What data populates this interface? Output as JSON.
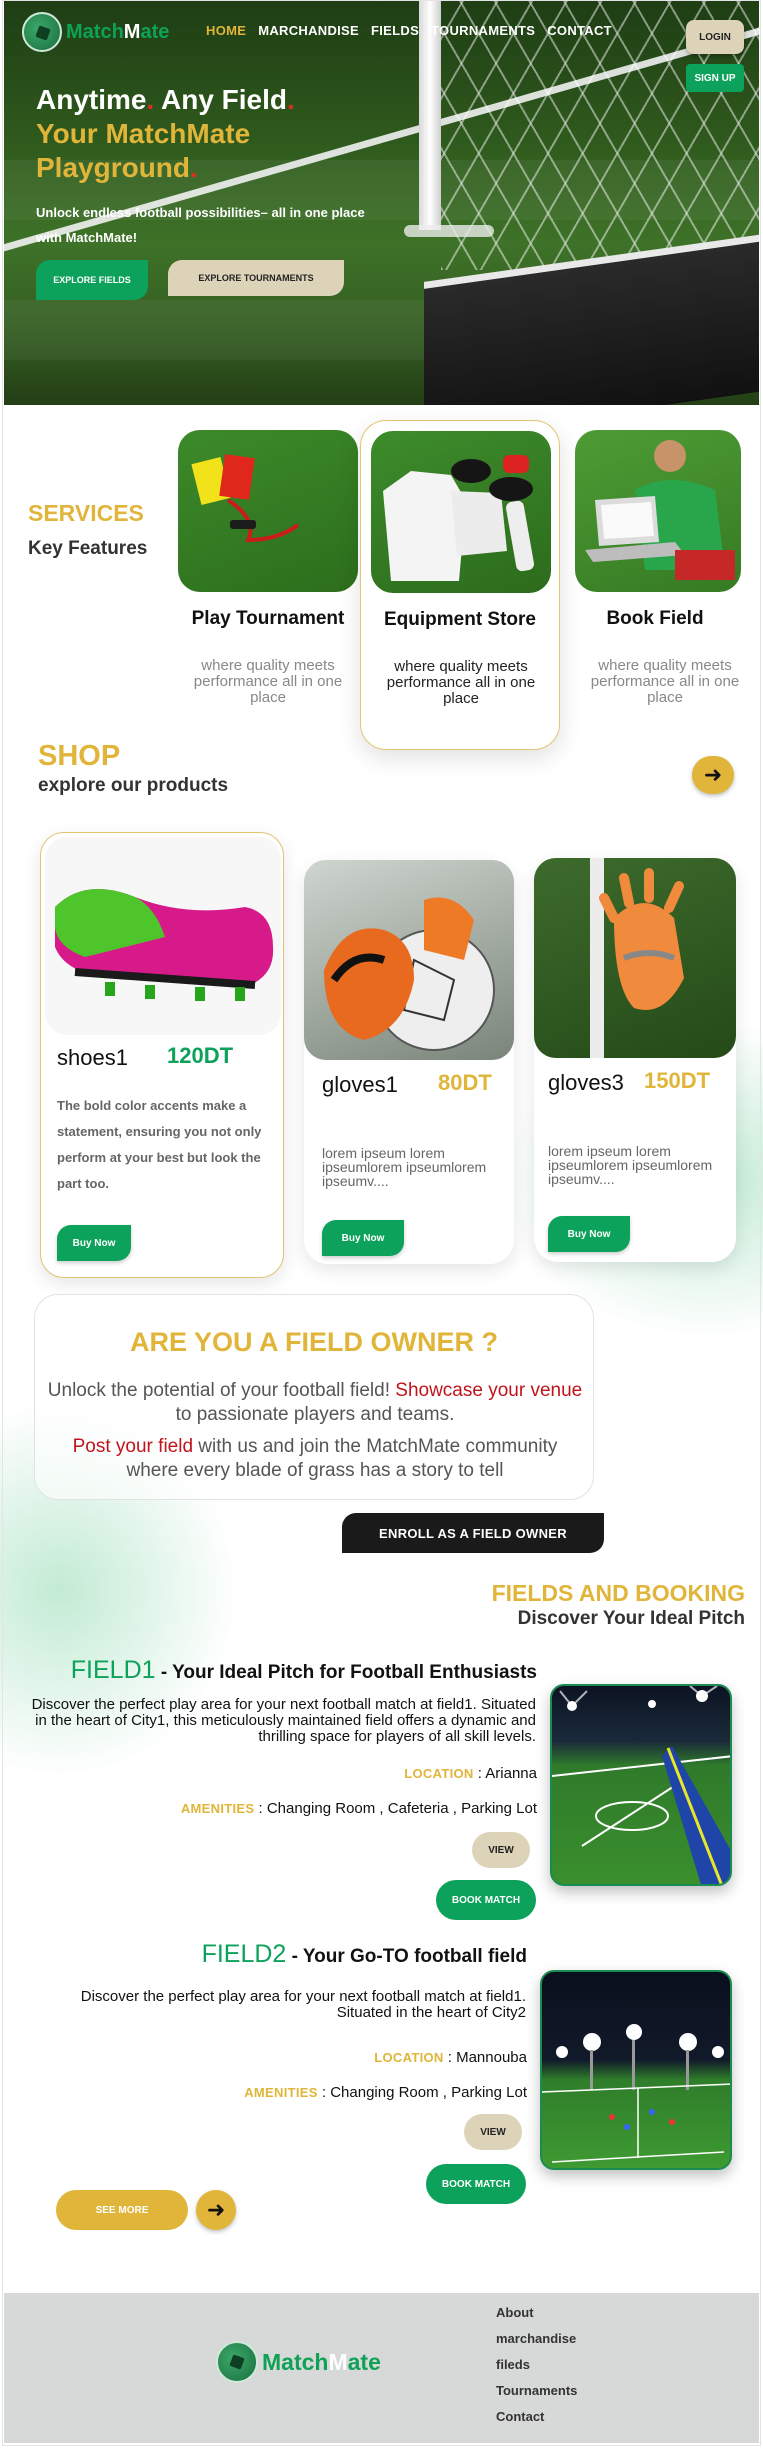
{
  "brand": {
    "name_pre": "Match",
    "name_m": "M",
    "name_post": "ate"
  },
  "nav": {
    "links": [
      "HOME",
      "MARCHANDISE",
      "FIELDS",
      "TOURNAMENTS",
      "CONTACT"
    ],
    "login_label": "LOGIN",
    "signup_label": "SIGN UP"
  },
  "hero": {
    "title_line1_a": "Anytime",
    "title_dot": ".",
    "title_line1_b": " Any Field",
    "title_line2": "Your MatchMate",
    "title_line3": "Playground",
    "subtitle": "Unlock endless football possibilities– all in one place with MatchMate!",
    "btn_fields": "EXPLORE FIELDS",
    "btn_tournaments": "EXPLORE TOURNAMENTS"
  },
  "services": {
    "tag": "SERVICES",
    "subtitle": "Key Features",
    "cards": [
      {
        "title": "Play Tournament",
        "desc": "where quality meets performance all in one place"
      },
      {
        "title": "Equipment Store",
        "desc": "where quality meets performance all in one place"
      },
      {
        "title": "Book Field",
        "desc": "where quality meets performance all in one place"
      }
    ]
  },
  "shop": {
    "tag": "SHOP",
    "subtitle": "explore our products",
    "products": [
      {
        "name": "shoes1",
        "price": "120DT",
        "desc": "The bold color accents make a statement, ensuring you not only perform at your best but look the part too.",
        "buy": "Buy Now"
      },
      {
        "name": "gloves1",
        "price": "80DT",
        "desc": "lorem ipseum lorem ipseumlorem ipseumlorem ipseumv....",
        "buy": "Buy Now"
      },
      {
        "name": "gloves3",
        "price": "150DT",
        "desc": "lorem ipseum lorem ipseumlorem ipseumlorem ipseumv....",
        "buy": "Buy Now"
      }
    ]
  },
  "owner": {
    "title": "ARE YOU A FIELD OWNER ?",
    "line1_a": "Unlock the potential of your football field! ",
    "line1_red": "Showcase your venue",
    "line1_b": " to passionate players and teams.",
    "line2_red": "Post your field",
    "line2_b": " with us and join the MatchMate community where every blade of grass has a story to tell",
    "enroll_label": "ENROLL AS A FIELD OWNER"
  },
  "fields": {
    "tag": "FIELDS AND BOOKING",
    "subtitle": "Discover Your Ideal Pitch",
    "location_key": "LOCATION",
    "amenities_key": "AMENITIES",
    "view_label": "VIEW",
    "book_label": "BOOK MATCH",
    "items": [
      {
        "name": "FIELD1",
        "tagline": " - Your Ideal Pitch for Football Enthusiasts",
        "desc": "Discover the perfect play area for your next football match at field1. Situated in the heart of City1, this meticulously maintained field offers a dynamic and thrilling space for players of all skill levels.",
        "location": " : Arianna",
        "amenities": " : Changing Room , Cafeteria , Parking Lot"
      },
      {
        "name": "FIELD2",
        "tagline": " - Your Go-TO football field",
        "desc": "Discover the perfect play area for your next football match at field1. Situated in the heart of City2",
        "location": " : Mannouba",
        "amenities": " : Changing Room ,  Parking Lot"
      }
    ],
    "see_more_label": "SEE MORE"
  },
  "footer": {
    "links": [
      "About",
      "marchandise",
      "fileds",
      "Tournaments",
      "Contact"
    ]
  },
  "colors": {
    "accent_gold": "#e0b53a",
    "brand_green": "#0da25b",
    "dark": "#1a1a1a",
    "highlight_red": "#c0141c"
  },
  "icons": {
    "arrow": "arrow-right-icon",
    "logo": "soccer-ball-icon"
  }
}
